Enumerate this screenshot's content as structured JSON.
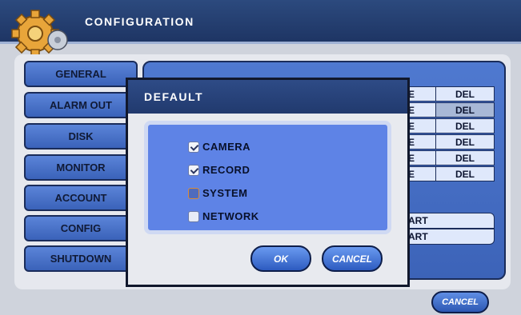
{
  "header": {
    "title": "CONFIGURATION"
  },
  "menu": {
    "items": [
      "GENERAL",
      "ALARM OUT",
      "DISK",
      "MONITOR",
      "ACCOUNT",
      "CONFIG",
      "SHUTDOWN"
    ]
  },
  "table": {
    "rows": [
      {
        "action": "E",
        "del": "DEL"
      },
      {
        "action": "E",
        "del": "DEL"
      },
      {
        "action": "E",
        "del": "DEL"
      },
      {
        "action": "E",
        "del": "DEL"
      },
      {
        "action": "E",
        "del": "DEL"
      },
      {
        "action": "E",
        "del": "DEL"
      }
    ],
    "art": [
      "ART",
      "ART"
    ]
  },
  "bottom": {
    "cancel_label": "CANCEL"
  },
  "dialog": {
    "title": "DEFAULT",
    "options": [
      {
        "label": "CAMERA",
        "checked": true
      },
      {
        "label": "RECORD",
        "checked": true
      },
      {
        "label": "SYSTEM",
        "checked": false
      },
      {
        "label": "NETWORK",
        "checked": false
      }
    ],
    "ok_label": "OK",
    "cancel_label": "CANCEL"
  },
  "colors": {
    "header_bg": "#2c4a7e",
    "menu_blue": "#4a72c8",
    "panel_blue": "#5e83e6",
    "focus_border": "#d98c3a"
  }
}
